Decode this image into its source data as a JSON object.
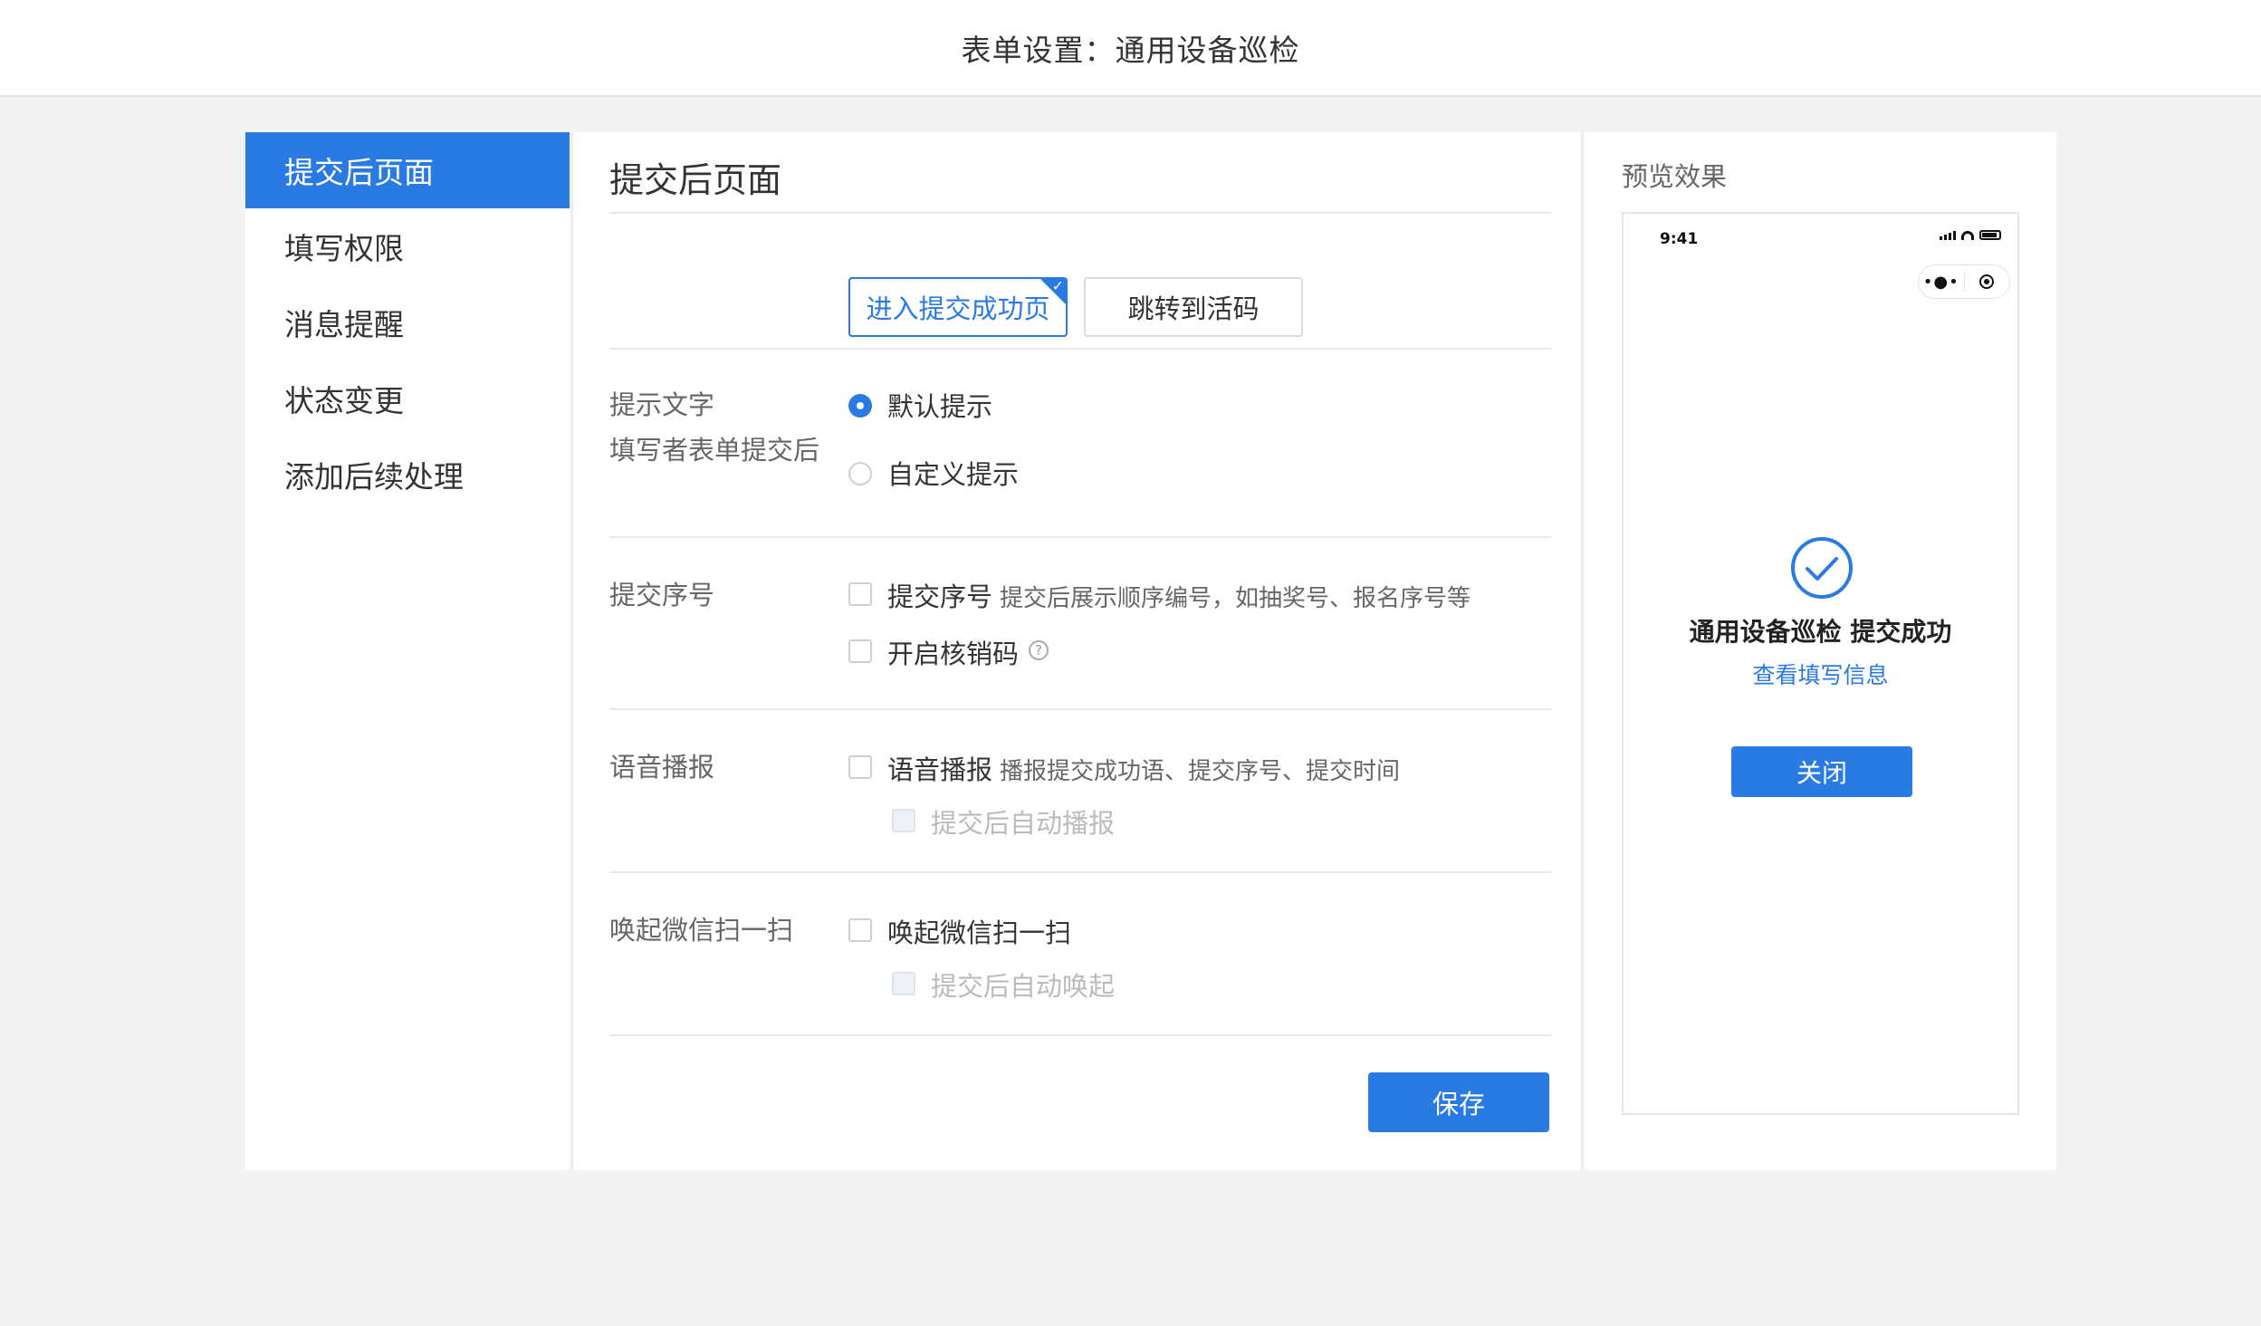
{
  "header": {
    "title": "表单设置：通用设备巡检"
  },
  "sidebar": {
    "items": [
      {
        "label": "提交后页面",
        "active": true
      },
      {
        "label": "填写权限",
        "active": false
      },
      {
        "label": "消息提醒",
        "active": false
      },
      {
        "label": "状态变更",
        "active": false
      },
      {
        "label": "添加后续处理",
        "active": false
      }
    ]
  },
  "main": {
    "title": "提交后页面",
    "after_submit": {
      "label": "填写者表单提交后",
      "options": [
        "进入提交成功页",
        "跳转到活码"
      ],
      "selected": "进入提交成功页"
    },
    "prompt_text": {
      "label": "提示文字",
      "options": [
        "默认提示",
        "自定义提示"
      ],
      "selected": "默认提示"
    },
    "submit_number": {
      "label": "提交序号",
      "option_label": "提交序号",
      "option_desc": "提交后展示顺序编号，如抽奖号、报名序号等",
      "verify_label": "开启核销码",
      "help_icon": "question-circle-icon"
    },
    "voice": {
      "label": "语音播报",
      "option_label": "语音播报",
      "option_desc": "播报提交成功语、提交序号、提交时间",
      "auto_label": "提交后自动播报"
    },
    "wechat_scan": {
      "label": "唤起微信扫一扫",
      "option_label": "唤起微信扫一扫",
      "auto_label": "提交后自动唤起"
    },
    "save_label": "保存"
  },
  "preview": {
    "title": "预览效果",
    "status_time": "9:41",
    "success_text": "通用设备巡检 提交成功",
    "view_link": "查看填写信息",
    "close_label": "关闭"
  },
  "colors": {
    "accent": "#2a7ae4",
    "background": "#f3f3f3"
  }
}
